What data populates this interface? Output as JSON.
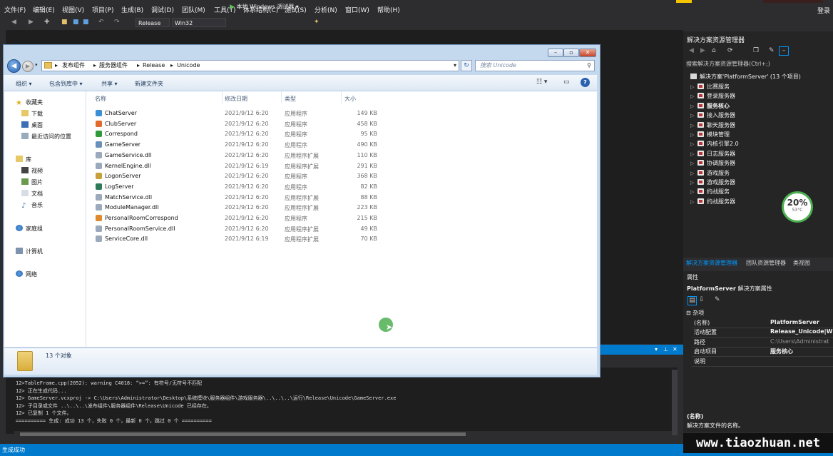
{
  "menu": [
    "文件(F)",
    "编辑(E)",
    "视图(V)",
    "项目(P)",
    "生成(B)",
    "调试(D)",
    "团队(M)",
    "工具(T)",
    "体系结构(C)",
    "测试(S)",
    "分析(N)",
    "窗口(W)",
    "帮助(H)"
  ],
  "login": "登录",
  "toolbar": {
    "config": "Release",
    "platform": "Win32",
    "run_label": "本地 Windows 调试器",
    "run_icon": "play-icon"
  },
  "solution_explorer": {
    "title": "解决方案资源管理器",
    "search_placeholder": "搜索解决方案资源管理器(Ctrl+;)",
    "root": "解决方案'PlatformServer' (13 个项目)",
    "items": [
      {
        "label": "比赛服务",
        "bold": false
      },
      {
        "label": "登录服务器",
        "bold": false
      },
      {
        "label": "服务核心",
        "bold": true
      },
      {
        "label": "接入服务器",
        "bold": false
      },
      {
        "label": "聊天服务器",
        "bold": false
      },
      {
        "label": "模块管理",
        "bold": false
      },
      {
        "label": "内核引擎2.0",
        "bold": false
      },
      {
        "label": "日志服务器",
        "bold": false
      },
      {
        "label": "协调服务器",
        "bold": false
      },
      {
        "label": "游戏服务",
        "bold": false
      },
      {
        "label": "游戏服务器",
        "bold": false
      },
      {
        "label": "约战服务",
        "bold": false
      },
      {
        "label": "约战服务器",
        "bold": false
      }
    ],
    "tabs": [
      "解决方案资源管理器",
      "团队资源管理器",
      "类视图"
    ]
  },
  "gauge": {
    "percent": "20%",
    "temp": "53°C",
    "color": "#4caf50"
  },
  "properties": {
    "title": "属性",
    "object": "PlatformServer",
    "object_type": "解决方案属性",
    "category": "杂项",
    "rows": [
      {
        "key": "(名称)",
        "value": "PlatformServer",
        "dim": false
      },
      {
        "key": "活动配置",
        "value": "Release_Unicode|Win",
        "dim": false
      },
      {
        "key": "路径",
        "value": "C:\\Users\\Administrat",
        "dim": true
      },
      {
        "key": "启动项目",
        "value": "服务核心",
        "dim": false
      },
      {
        "key": "说明",
        "value": "",
        "dim": false
      }
    ],
    "desc_title": "(名称)",
    "desc": "解决方案文件的名称。"
  },
  "output": {
    "lines": [
      "12>TableFrame.cpp(2052): warning C4018: “>=”: 有符号/无符号不匹配",
      "12>  正在生成代码...",
      "12>  GameServer.vcxproj -> C:\\Users\\Administrator\\Desktop\\系统模块\\服务器组件\\游戏服务器\\..\\..\\..\\运行\\Release\\Unicode\\GameServer.exe",
      "12>  子目录或文件 ..\\..\\..\\发布组件\\服务器组件\\Release\\Unicode 已经存在。",
      "12>  已复制         1 个文件。",
      "========== 生成: 成功 13 个，失败 0 个，最新 0 个，跳过 0 个 =========="
    ]
  },
  "status": "生成成功",
  "watermark": "www.tiaozhuan.net",
  "explorer": {
    "breadcrumb": [
      "发布组件",
      "服务器组件",
      "Release",
      "Unicode"
    ],
    "search_placeholder": "搜索 Unicode",
    "commands": [
      "组织 ▾",
      "包含到库中 ▾",
      "共享 ▾",
      "新建文件夹"
    ],
    "nav": {
      "favorites": "收藏夹",
      "fav_items": [
        "下载",
        "桌面",
        "最近访问的位置"
      ],
      "libraries": "库",
      "lib_items": [
        "视频",
        "图片",
        "文档",
        "音乐"
      ],
      "homegroup": "家庭组",
      "computer": "计算机",
      "network": "网络"
    },
    "columns": [
      "名称",
      "修改日期",
      "类型",
      "大小"
    ],
    "files": [
      {
        "name": "ChatServer",
        "date": "2021/9/12 6:20",
        "type": "应用程序",
        "size": "149 KB",
        "icon": "#3b8fd6"
      },
      {
        "name": "ClubServer",
        "date": "2021/9/12 6:20",
        "type": "应用程序",
        "size": "458 KB",
        "icon": "#e06a2c"
      },
      {
        "name": "Correspond",
        "date": "2021/9/12 6:20",
        "type": "应用程序",
        "size": "95 KB",
        "icon": "#2f9a3a"
      },
      {
        "name": "GameServer",
        "date": "2021/9/12 6:20",
        "type": "应用程序",
        "size": "490 KB",
        "icon": "#6a8fb8"
      },
      {
        "name": "GameService.dll",
        "date": "2021/9/12 6:20",
        "type": "应用程序扩展",
        "size": "110 KB",
        "icon": "#9aa9bb"
      },
      {
        "name": "KernelEngine.dll",
        "date": "2021/9/12 6:19",
        "type": "应用程序扩展",
        "size": "291 KB",
        "icon": "#9aa9bb"
      },
      {
        "name": "LogonServer",
        "date": "2021/9/12 6:20",
        "type": "应用程序",
        "size": "368 KB",
        "icon": "#c8a03a"
      },
      {
        "name": "LogServer",
        "date": "2021/9/12 6:20",
        "type": "应用程序",
        "size": "82 KB",
        "icon": "#2d7a5a"
      },
      {
        "name": "MatchService.dll",
        "date": "2021/9/12 6:20",
        "type": "应用程序扩展",
        "size": "88 KB",
        "icon": "#9aa9bb"
      },
      {
        "name": "ModuleManager.dll",
        "date": "2021/9/12 6:20",
        "type": "应用程序扩展",
        "size": "223 KB",
        "icon": "#9aa9bb"
      },
      {
        "name": "PersonalRoomCorrespond",
        "date": "2021/9/12 6:20",
        "type": "应用程序",
        "size": "215 KB",
        "icon": "#e08a2c"
      },
      {
        "name": "PersonalRoomService.dll",
        "date": "2021/9/12 6:20",
        "type": "应用程序扩展",
        "size": "49 KB",
        "icon": "#9aa9bb"
      },
      {
        "name": "ServiceCore.dll",
        "date": "2021/9/12 6:19",
        "type": "应用程序扩展",
        "size": "70 KB",
        "icon": "#9aa9bb"
      }
    ],
    "details": "13 个对象"
  }
}
